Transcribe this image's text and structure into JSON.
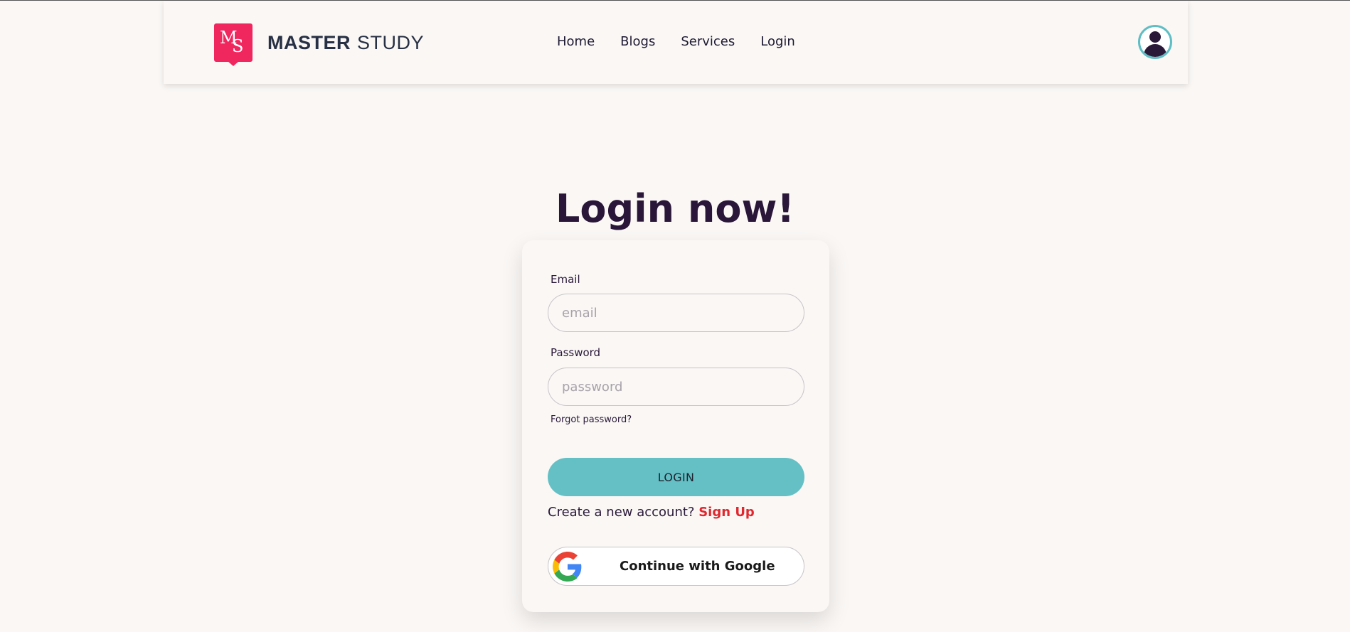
{
  "brand": {
    "badge_letter_1": "M",
    "badge_letter_2": "S",
    "name_bold": "MASTER",
    "name_light": "STUDY",
    "accent_color": "#f0265f"
  },
  "nav": {
    "items": [
      {
        "label": "Home"
      },
      {
        "label": "Blogs"
      },
      {
        "label": "Services"
      },
      {
        "label": "Login"
      }
    ],
    "avatar_icon": "user-avatar-icon"
  },
  "main": {
    "title": "Login now!"
  },
  "form": {
    "email_label": "Email",
    "email_placeholder": "email",
    "email_value": "",
    "password_label": "Password",
    "password_placeholder": "password",
    "password_value": "",
    "forgot_password": "Forgot password?",
    "login_button": "LOGIN",
    "login_button_color": "#64c0c5",
    "create_account_text": "Create a new account?",
    "signup_link": "Sign Up",
    "signup_color": "#e0282e",
    "google_button": "Continue with Google",
    "google_icon": "google-icon"
  }
}
